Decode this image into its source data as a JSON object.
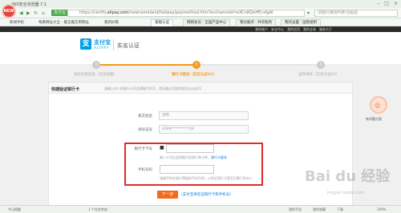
{
  "browser": {
    "app_title": "360安全浏览器 7.1",
    "logo_badge": "NEW",
    "secure_tag": "支付宝",
    "url_prefix": "https://certify.",
    "url_domain": "alipay.com",
    "url_rest": "/newnameland/fastpay/paymethod.htm?enchanceId=eXCnRQeHFj-sfgAI",
    "search_placeholder": "凉期只赚很叫新任服拍",
    "bookmarks": [
      "新闻手机",
      "每看网址大全 - 最全最实用网址",
      "我的好看",
      "安全检测"
    ],
    "tabs": [
      "基础认证",
      "网络会员 · 全国产品中心",
      "我也服务 · 共享服务",
      "我的设置 · 国际组织"
    ],
    "win_controls": [
      "–",
      "□",
      "×"
    ]
  },
  "topnav": [
    "我的账户",
    "安全中心",
    "我的信用",
    "我的全球",
    "服务大厅"
  ],
  "alipay": {
    "logo_char": "支",
    "name": "支付宝",
    "en": "ALIPAY",
    "page_title": "实名认证"
  },
  "steps": [
    {
      "num": "1",
      "label": "身份信息验证（实名初级）"
    },
    {
      "num": "2",
      "label": "银行卡验证（实名认证V1）"
    },
    {
      "num": "3",
      "label": "证件审核（实名认证V2）"
    }
  ],
  "tip": {
    "title": "快捷验证银行卡",
    "text": "请输入本人的银行卡号及预留手机号，验证通过后即完成实名认证V1"
  },
  "form": {
    "name_label": "真实姓名",
    "name_value": "汤怀",
    "id_label": "身份证号",
    "id_value": "4309**********6X",
    "card_label": "银行卡卡号",
    "card_hint": "输入卡号后会智能识别银行和卡种，",
    "card_hint_link": "银行卡要求",
    "phone_label": "手机号码",
    "phone_hint": "请填写你在银行预留的手机号码，以验证银行卡是否归属于你本人"
  },
  "next_button": "下一步",
  "next_link": "(支付宝将验证银行卡和手机号)",
  "side_widget": {
    "label": "有问题点我",
    "face": "☺"
  },
  "status": {
    "left": "今日提醒",
    "center": "1 个任务完成",
    "right_items": [
      "我的手机",
      "我的收藏",
      "下载",
      "100%"
    ]
  },
  "watermark": {
    "main": "Bai du 经验",
    "sub": "jingyan.baidu.com"
  },
  "colors": {
    "accent": "#f39b1b",
    "alipay_blue": "#00a0e9",
    "highlight_red": "#e12b2b",
    "button": "#f26b1d"
  }
}
